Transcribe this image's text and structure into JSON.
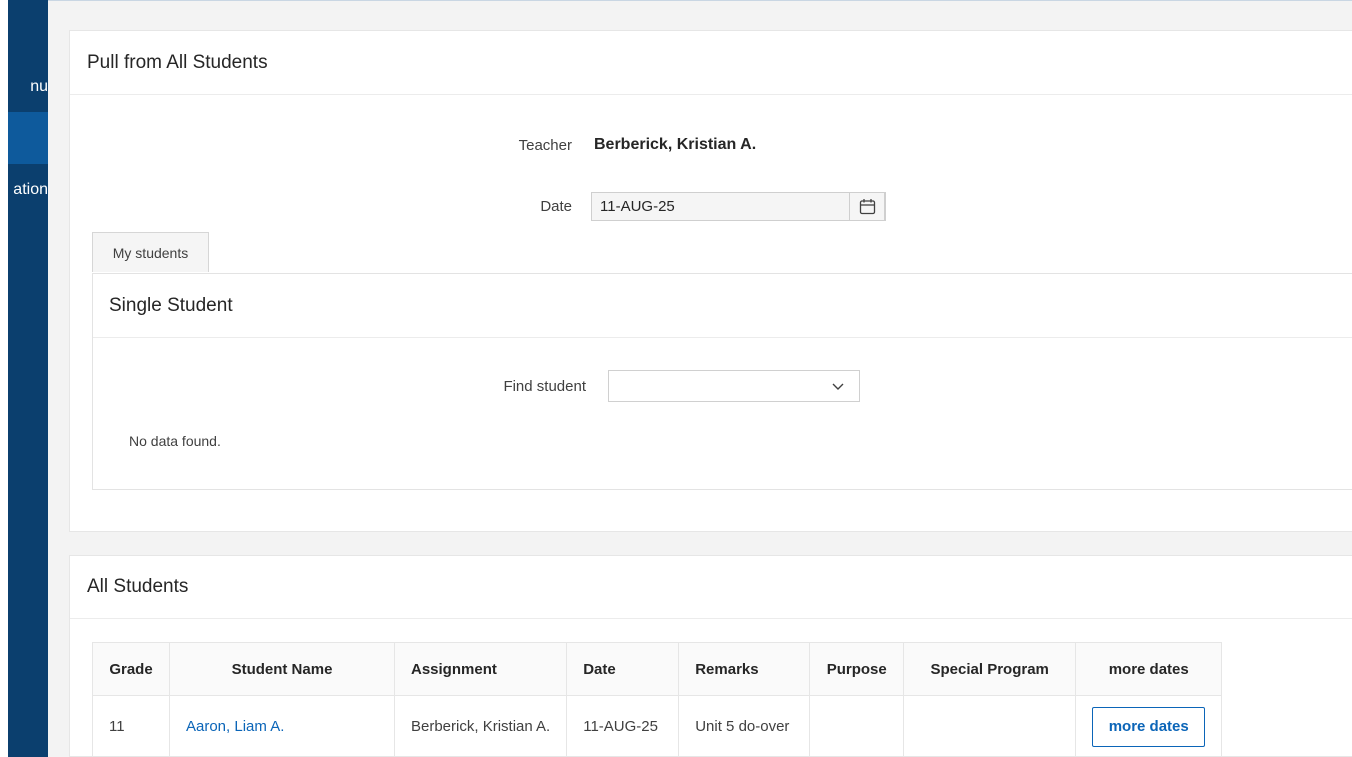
{
  "sidebar": {
    "menu_fragment": "nu",
    "nav_fragment": "ation"
  },
  "pull_region": {
    "title": "Pull from All Students",
    "teacher_label": "Teacher",
    "teacher_value": "Berberick, Kristian A.",
    "date_label": "Date",
    "date_value": "11-AUG-25",
    "tab_label": "My students"
  },
  "single_student": {
    "title": "Single Student",
    "find_label": "Find student",
    "find_value": "",
    "no_data": "No data found."
  },
  "all_students": {
    "title": "All Students",
    "columns": [
      "Grade",
      "Student Name",
      "Assignment",
      "Date",
      "Remarks",
      "Purpose",
      "Special Program",
      "more dates"
    ],
    "rows": [
      {
        "grade": "11",
        "student_name": "Aaron, Liam A.",
        "assignment": "Berberick, Kristian A.",
        "date": "11-AUG-25",
        "remarks": "Unit 5 do-over",
        "purpose": "",
        "special_program": "",
        "more_dates_label": "more dates"
      }
    ]
  },
  "colors": {
    "sidebar": "#0b3f6e",
    "sidebar_active": "#0e5a9c",
    "link": "#0b65b8"
  }
}
